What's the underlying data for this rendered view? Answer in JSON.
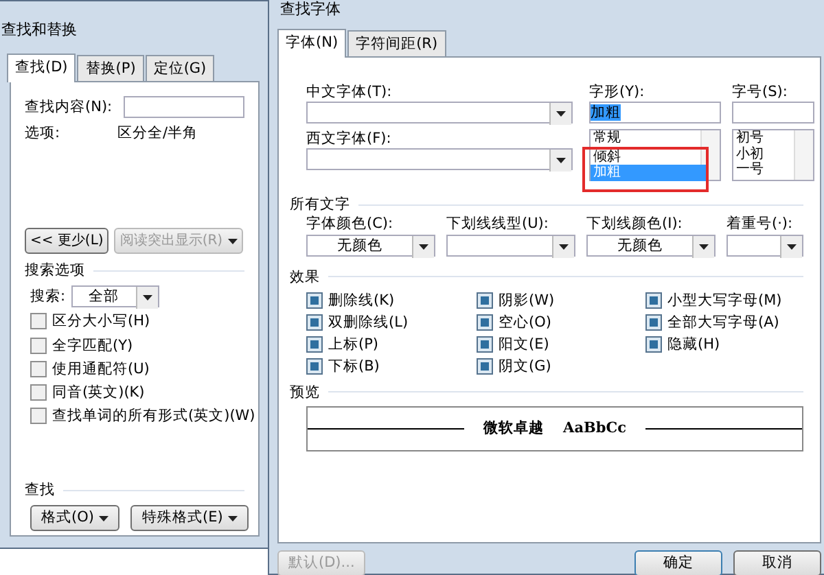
{
  "find_replace": {
    "title": "查找和替换",
    "tabs": [
      {
        "label": "查找(D)",
        "selected": true
      },
      {
        "label": "替换(P)",
        "selected": false
      },
      {
        "label": "定位(G)",
        "selected": false
      }
    ],
    "find_label": "查找内容(N):",
    "options_label": "选项:",
    "options_value": "区分全/半角",
    "less_button": "<< 更少(L)",
    "highlight_button": {
      "label": "阅读突出显示(R)",
      "disabled": true
    },
    "search_options_title": "搜索选项",
    "search_label": "搜索:",
    "search_value": "全部",
    "checkboxes": [
      {
        "label": "区分大小写(H)",
        "checked": false
      },
      {
        "label": "全字匹配(Y)",
        "checked": false
      },
      {
        "label": "使用通配符(U)",
        "checked": false
      },
      {
        "label": "同音(英文)(K)",
        "checked": false
      },
      {
        "label": "查找单词的所有形式(英文)(W)",
        "checked": false
      }
    ],
    "find_section_title": "查找",
    "buttons": [
      "格式(O)",
      "特殊格式(E)"
    ]
  },
  "find_font": {
    "title": "查找字体",
    "tabs": [
      {
        "label": "字体(N)",
        "selected": true
      },
      {
        "label": "字符间距(R)",
        "selected": false
      }
    ],
    "chinese_font_label": "中文字体(T):",
    "western_font_label": "西文字体(F):",
    "style": {
      "label": "字形(Y):",
      "value": "加粗",
      "options": [
        {
          "label": "常规",
          "selected": false
        },
        {
          "label": "倾斜",
          "selected": false
        },
        {
          "label": "加粗",
          "selected": true
        }
      ]
    },
    "size": {
      "label": "字号(S):",
      "options": [
        "初号",
        "小初",
        "一号"
      ]
    },
    "all_text_title": "所有文字",
    "combos": [
      {
        "label": "字体颜色(C):",
        "value": "无颜色"
      },
      {
        "label": "下划线线型(U):"
      },
      {
        "label": "下划线颜色(I):",
        "value": "无颜色"
      },
      {
        "label": "着重号(·):"
      }
    ],
    "effects_title": "效果",
    "effects": [
      [
        {
          "label": "删除线(K)",
          "indeterminate": true
        },
        {
          "label": "双删除线(L)",
          "indeterminate": true
        },
        {
          "label": "上标(P)",
          "indeterminate": true
        },
        {
          "label": "下标(B)",
          "indeterminate": true
        }
      ],
      [
        {
          "label": "阴影(W)",
          "indeterminate": true
        },
        {
          "label": "空心(O)",
          "indeterminate": true
        },
        {
          "label": "阳文(E)",
          "indeterminate": true
        },
        {
          "label": "阴文(G)",
          "indeterminate": true
        }
      ],
      [
        {
          "label": "小型大写字母(M)",
          "indeterminate": true
        },
        {
          "label": "全部大写字母(A)",
          "indeterminate": true
        },
        {
          "label": "隐藏(H)",
          "indeterminate": true
        }
      ]
    ],
    "preview_title": "预览",
    "preview_cjk": "微软卓越",
    "preview_latin": "AaBbCc",
    "default_button": {
      "label": "默认(D)...",
      "disabled": true
    },
    "ok_button": "确定",
    "cancel_button": "取消"
  }
}
